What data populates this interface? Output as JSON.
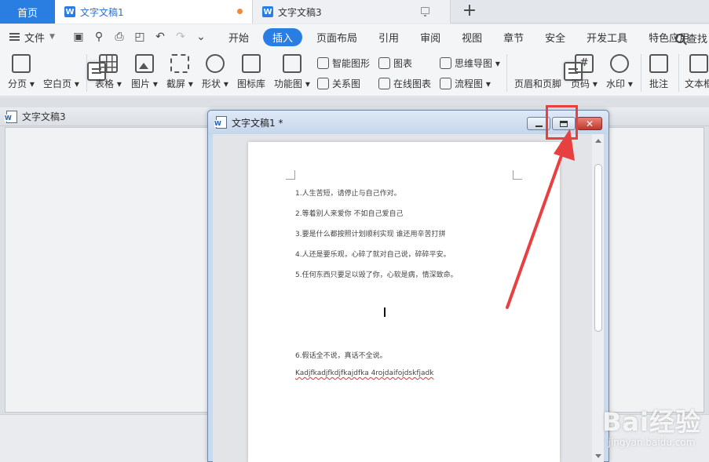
{
  "tabs": {
    "home": "首页",
    "active": "文字文稿1",
    "inactive": "文字文稿3",
    "add": "+"
  },
  "menu": {
    "file": "文件",
    "items": [
      "开始",
      "插入",
      "页面布局",
      "引用",
      "审阅",
      "视图",
      "章节",
      "安全",
      "开发工具",
      "特色应用"
    ],
    "active_index": 1,
    "search": "查找"
  },
  "ribbon": {
    "fenye": "分页",
    "kongbaiye": "空白页",
    "biaoge": "表格",
    "tupian": "图片",
    "jieping": "截屏",
    "xingzhuang": "形状",
    "tubiaoku": "图标库",
    "gongnengtu": "功能图",
    "zhinengtuxing": "智能图形",
    "tubiao": "图表",
    "siweidaotu": "思维导图",
    "guanxitu": "关系图",
    "zaixiantubiao": "在线图表",
    "liuchengtu": "流程图",
    "yemeiheyejiao": "页眉和页脚",
    "yema": "页码",
    "shuiyin": "水印",
    "pizhu": "批注",
    "wenbenkuang": "文本框"
  },
  "window_doc3": {
    "title": "文字文稿3"
  },
  "window_doc1": {
    "title": "文字文稿1 *",
    "close_glyph": "✕",
    "lines": [
      "1.人生苦短，请停止与自己作对。",
      "2.等着别人来爱你 不如自己爱自己",
      "3.要是什么都按照计划顺利实现 谁还用辛苦打拼",
      "4.人还是要乐观，心碎了就对自己说，碎碎平安。",
      "5.任何东西只要足以毁了你，心软是病，情深致命。",
      "6.假话全不说，真话不全说。",
      "Kadjfkadjfkdjfkajdfka 4rojdaifojdskfjadk"
    ]
  },
  "watermark": {
    "brand": "Bai经验",
    "url": "jingyan.baidu.com"
  },
  "colors": {
    "accent": "#2a7de1",
    "highlight": "#e84040",
    "close": "#c0392b"
  }
}
